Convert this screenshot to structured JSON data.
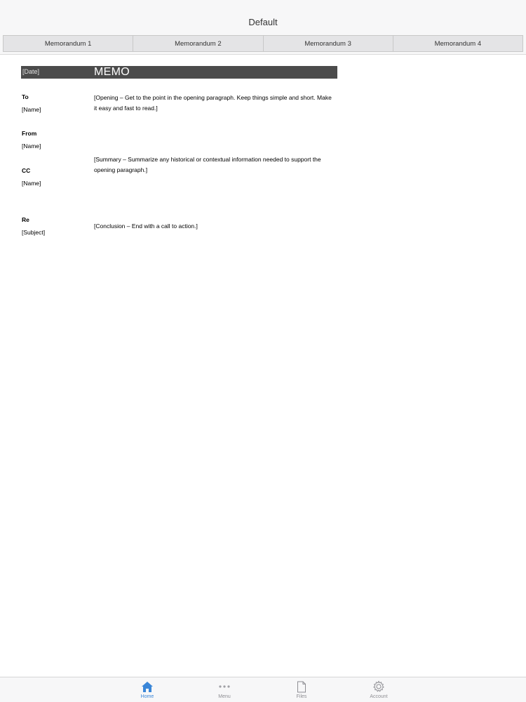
{
  "navbar": {
    "title": "Default"
  },
  "segments": [
    "Memorandum 1",
    "Memorandum 2",
    "Memorandum 3",
    "Memorandum 4"
  ],
  "memo": {
    "date": "[Date]",
    "title": "MEMO",
    "to_label": "To",
    "to_value": "[Name]",
    "from_label": "From",
    "from_value": "[Name]",
    "cc_label": "CC",
    "cc_value": "[Name]",
    "re_label": "Re",
    "re_value": "[Subject]",
    "opening": "[Opening – Get to the point in the opening paragraph. Keep things simple and short. Make it easy and fast to read.]",
    "summary": "[Summary – Summarize any historical or contextual information needed to support the opening paragraph.]",
    "conclusion": "[Conclusion – End with a call to action.]"
  },
  "tabbar": {
    "items": [
      {
        "label": "Home",
        "icon": "home-icon",
        "active": true
      },
      {
        "label": "Menu",
        "icon": "more-icon",
        "active": false
      },
      {
        "label": "Files",
        "icon": "file-icon",
        "active": false
      },
      {
        "label": "Account",
        "icon": "gear-icon",
        "active": false
      }
    ]
  },
  "colors": {
    "accent": "#3a86d8",
    "memo_bar": "#4b4b4b",
    "inactive": "#8e8e93"
  }
}
